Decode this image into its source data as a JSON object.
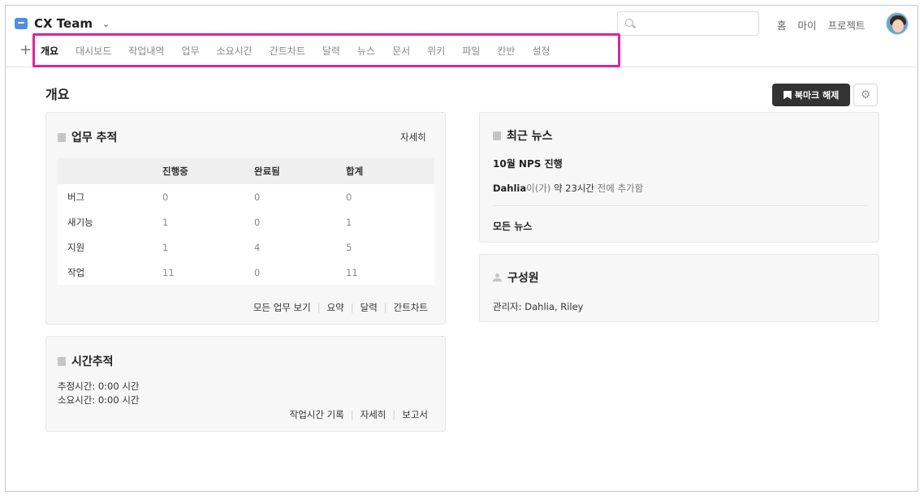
{
  "project": {
    "name": "CX Team"
  },
  "search": {
    "placeholder": ""
  },
  "topnav": [
    "홈",
    "마이",
    "프로젝트"
  ],
  "tabs": [
    "개요",
    "대시보드",
    "작업내역",
    "업무",
    "소요시간",
    "간트차트",
    "달력",
    "뉴스",
    "문서",
    "위키",
    "파일",
    "칸반",
    "설정"
  ],
  "page": {
    "title": "개요",
    "bookmark_label": "북마크 해제"
  },
  "issues": {
    "title": "업무 추적",
    "detail_link": "자세히",
    "headers": [
      "",
      "진행중",
      "완료됨",
      "합계"
    ],
    "rows": [
      [
        "버그",
        "0",
        "0",
        "0"
      ],
      [
        "새기능",
        "1",
        "0",
        "1"
      ],
      [
        "지원",
        "1",
        "4",
        "5"
      ],
      [
        "작업",
        "11",
        "0",
        "11"
      ]
    ],
    "links": [
      "모든 업무 보기",
      "요약",
      "달력",
      "간트차트"
    ]
  },
  "time": {
    "title": "시간추적",
    "estimated": "추정시간: 0:00 시간",
    "spent": "소요시간: 0:00 시간",
    "links": [
      "작업시간 기록",
      "자세히",
      "보고서"
    ]
  },
  "news": {
    "title": "최근 뉴스",
    "item_title": "10월 NPS 진행",
    "author": "Dahlia",
    "meta_suffix_1": "이(가) ",
    "meta_time": "약 23시간",
    "meta_suffix_2": " 전에 추가함",
    "all_news": "모든 뉴스"
  },
  "members": {
    "title": "구성원",
    "managers": "관리자: Dahlia, Riley"
  },
  "colors": {
    "highlight": "#e2239a",
    "project_icon": "#4f8fe6",
    "button_dark": "#333333"
  }
}
